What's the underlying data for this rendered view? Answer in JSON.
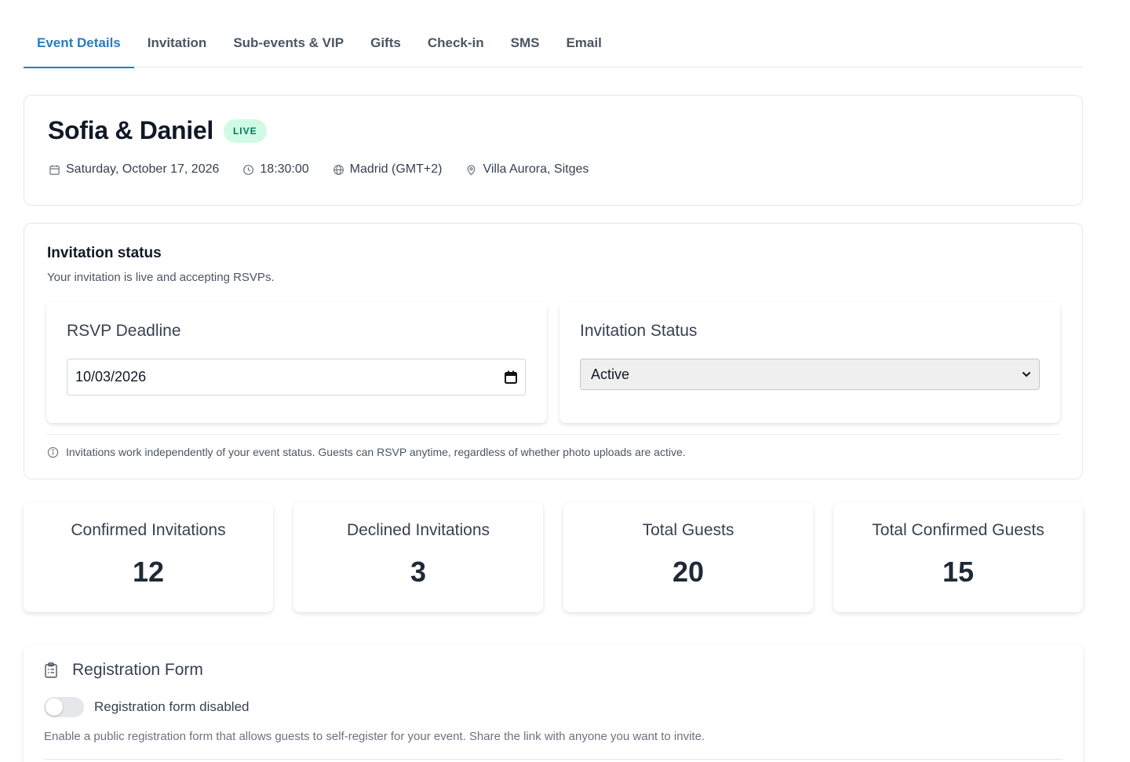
{
  "tabs": [
    {
      "label": "Event Details"
    },
    {
      "label": "Invitation"
    },
    {
      "label": "Sub-events & VIP"
    },
    {
      "label": "Gifts"
    },
    {
      "label": "Check-in"
    },
    {
      "label": "SMS"
    },
    {
      "label": "Email"
    }
  ],
  "active_tab": "Event Details",
  "event": {
    "title": "Sofia & Daniel",
    "badge": "LIVE",
    "date": "Saturday, October 17, 2026",
    "time": "18:30:00",
    "timezone": "Madrid (GMT+2)",
    "location": "Villa Aurora, Sitges",
    "icons": [
      "calendar-icon",
      "clock-icon",
      "globe-icon",
      "map-pin-icon"
    ]
  },
  "invitation_status": {
    "title": "Invitation status",
    "subtitle": "Your invitation is live and accepting RSVPs.",
    "rsvp_deadline": {
      "label": "RSVP Deadline",
      "value": "10/03/2026"
    },
    "status_select": {
      "label": "Invitation Status",
      "value": "Active"
    },
    "note": "Invitations work independently of your event status. Guests can RSVP anytime, regardless of whether photo uploads are active."
  },
  "stats": [
    {
      "label": "Confirmed Invitations",
      "value": "12"
    },
    {
      "label": "Declined Invitations",
      "value": "3"
    },
    {
      "label": "Total Guests",
      "value": "20"
    },
    {
      "label": "Total Confirmed Guests",
      "value": "15"
    }
  ],
  "registration": {
    "title": "Registration Form",
    "toggle_label": "Registration form disabled",
    "toggle_on": false,
    "description": "Enable a public registration form that allows guests to self-register for your event. Share the link with anyone you want to invite."
  },
  "colors": {
    "accent": "#2b7bbf",
    "live_badge_bg": "#d1fae5",
    "live_badge_text": "#047857"
  }
}
